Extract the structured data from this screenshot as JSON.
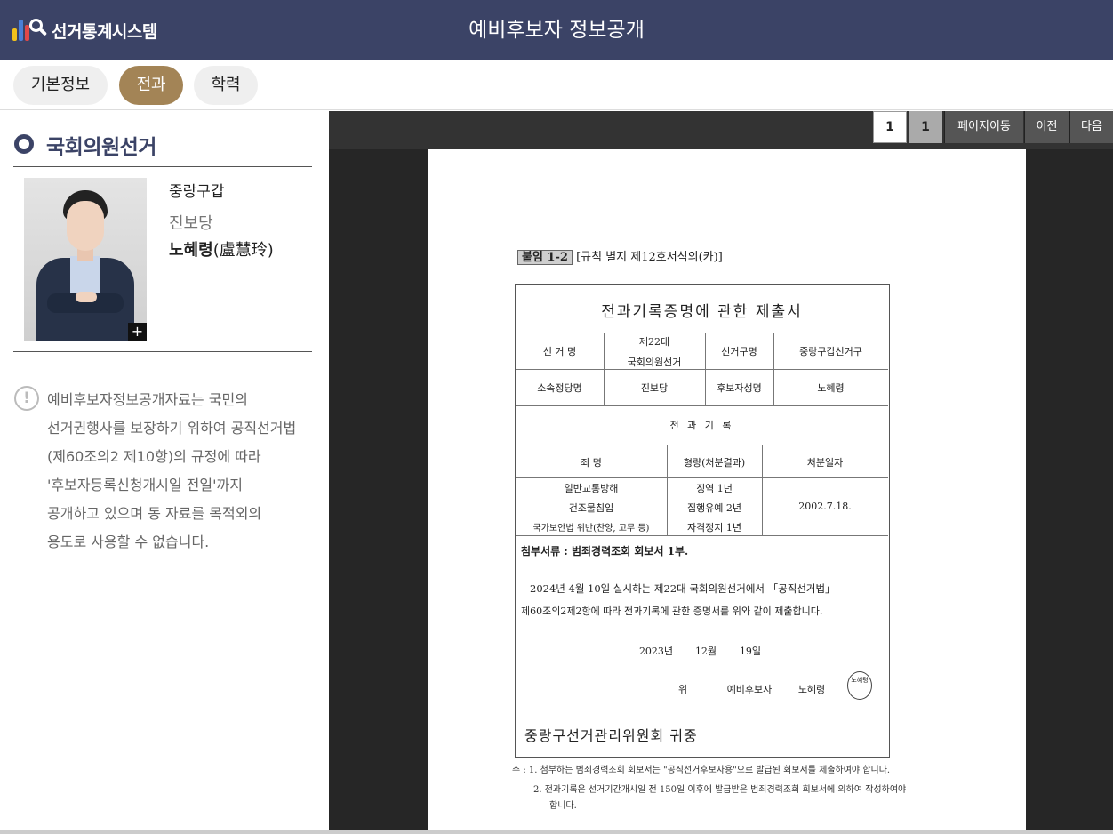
{
  "app": {
    "logo_text": "선거통계시스템",
    "title": "예비후보자 정보공개"
  },
  "tabs": [
    {
      "label": "기본정보",
      "active": false
    },
    {
      "label": "전과",
      "active": true
    },
    {
      "label": "학력",
      "active": false
    }
  ],
  "candidate": {
    "section_title": "국회의원선거",
    "district": "중랑구갑",
    "party": "진보당",
    "name": "노혜령",
    "name_hanja": "(盧慧玲)",
    "photo_expand_label": "+"
  },
  "notice": {
    "lines": [
      "예비후보자정보공개자료는 국민의",
      "선거권행사를 보장하기 위하여 공직선거법",
      "(제60조의2 제10항)의 규정에 따라",
      "'후보자등록신청개시일 전일'까지",
      "공개하고 있으며 동 자료를 목적외의",
      "용도로 사용할 수 없습니다."
    ]
  },
  "viewer": {
    "current_page": "1",
    "total_pages": "1",
    "goto_label": "페이지이동",
    "prev_label": "이전",
    "next_label": "다음"
  },
  "document": {
    "tag": "붙임 1-2",
    "tag_note": "[규칙 별지 제12호서식의(카)]",
    "form_title": "전과기록증명에 관한 제출서",
    "fields": {
      "election_label": "선 거 명",
      "election_value_1": "제22대",
      "election_value_2": "국회의원선거",
      "district_label": "선거구명",
      "district_value": "중랑구갑선거구",
      "party_label": "소속정당명",
      "party_value": "진보당",
      "candidate_label": "후보자성명",
      "candidate_value": "노혜령"
    },
    "record_title": "전 과 기 록",
    "record_headers": [
      "죄 명",
      "형량(처분결과)",
      "처분일자"
    ],
    "record_crimes": [
      "일반교통방해",
      "건조물침입",
      "국가보안법 위반(찬양, 고무 등)"
    ],
    "record_sentences": [
      "징역 1년",
      "집행유예 2년",
      "자격정지 1년"
    ],
    "record_date": "2002.7.18.",
    "attachment": "첨부서류 : 범죄경력조회 회보서 1부.",
    "statement_1": "2024년 4월 10일 실시하는 제22대 국회의원선거에서 「공직선거법」",
    "statement_2": "제60조의2제2항에 따라 전과기록에 관한 증명서를 위와 같이 제출합니다.",
    "date_year": "2023년",
    "date_month": "12월",
    "date_day": "19일",
    "signer_prefix": "위",
    "signer_role": "예비후보자",
    "signer_name": "노혜령",
    "stamp_text": "노혜령",
    "addressee": "중랑구선거관리위원회 귀중",
    "footnote_1": "주 : 1. 첨부하는 범죄경력조회 회보서는 \"공직선거후보자용\"으로 발급된 회보서를 제출하여야 합니다.",
    "footnote_2": "2. 전과기록은 선거기간개시일 전 150일 이후에 발급받은 범죄경력조회 회보서에 의하여 작성하여야",
    "footnote_3": "합니다."
  },
  "colors": {
    "header_bg": "#3b4366",
    "active_tab": "#a38456",
    "viewer_bg": "#262626"
  }
}
